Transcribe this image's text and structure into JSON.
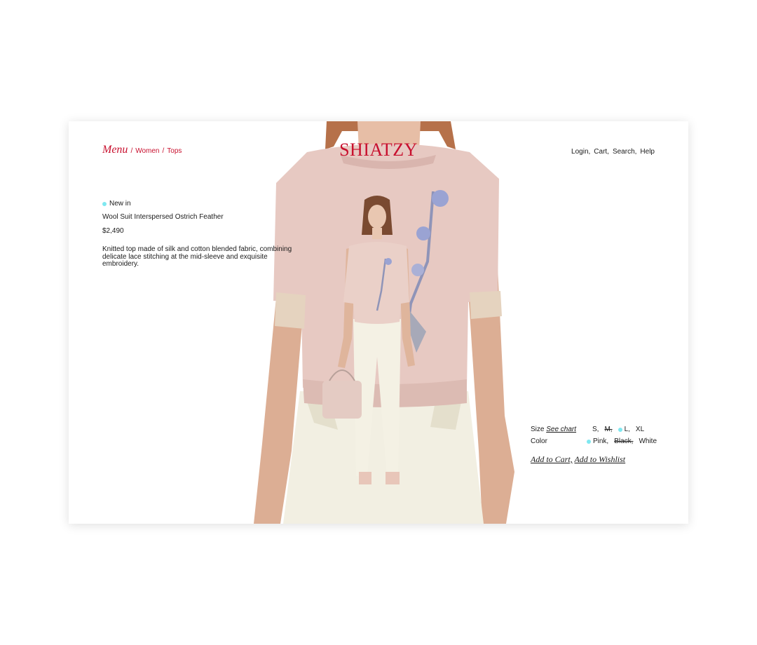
{
  "nav": {
    "menu_label": "Menu",
    "breadcrumb": [
      " / ",
      "Women",
      " / ",
      "Tops"
    ],
    "logo": "SHIATZY",
    "links": [
      "Login,",
      "Cart,",
      "Search,",
      "Help"
    ]
  },
  "product": {
    "badge": "New in",
    "name": "Wool Suit Interspersed Ostrich Feather",
    "price": "$2,490",
    "description_lines": [
      "Knitted top made of silk and cotton blended fabric, combining",
      "delicate lace stitching at the mid-sleeve and exquisite embroidery."
    ]
  },
  "options": {
    "size_label": "Size",
    "size_chart": "See chart",
    "sizes": [
      "S,",
      "M,",
      "L,",
      "XL"
    ],
    "color_label": "Color",
    "colors": [
      "Pink,",
      "Black,",
      "White"
    ]
  },
  "actions": {
    "add_to_cart": "Add to Cart,",
    "add_to_wishlist": "Add to Wishlist"
  },
  "colors": {
    "brand": "#c8102e",
    "selected_dot": "#7fe8f0",
    "top": "#e7c9c2",
    "pants": "#f1eee0"
  }
}
